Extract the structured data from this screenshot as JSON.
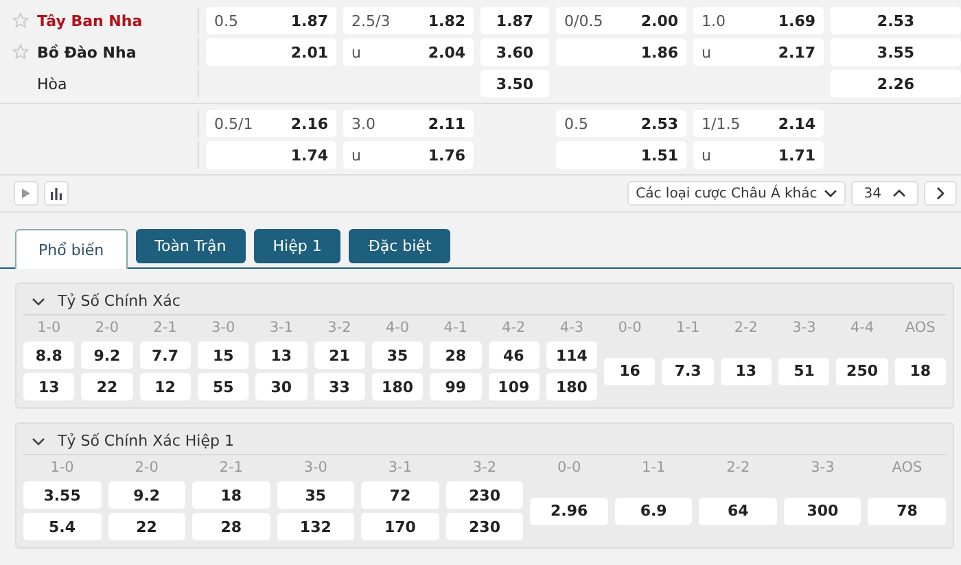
{
  "odds_blocks": [
    {
      "rows": [
        {
          "team": {
            "name": "Tây Ban Nha",
            "kind": "team",
            "highlighted": true
          },
          "cells": [
            {
              "kind": "pair",
              "label": "0.5",
              "odd": "1.87"
            },
            {
              "kind": "pair",
              "label": "2.5/3",
              "odd": "1.82"
            },
            {
              "kind": "single",
              "odd": "1.87"
            },
            {
              "kind": "pair",
              "label": "0/0.5",
              "odd": "2.00"
            },
            {
              "kind": "pair",
              "label": "1.0",
              "odd": "1.69"
            },
            {
              "kind": "single",
              "odd": "2.53"
            }
          ]
        },
        {
          "team": {
            "name": "Bồ Đào Nha",
            "kind": "team",
            "highlighted": false
          },
          "cells": [
            {
              "kind": "pair",
              "odd": "2.01"
            },
            {
              "kind": "pair",
              "label": "u",
              "odd": "2.04"
            },
            {
              "kind": "single",
              "odd": "3.60"
            },
            {
              "kind": "pair",
              "odd": "1.86"
            },
            {
              "kind": "pair",
              "label": "u",
              "odd": "2.17"
            },
            {
              "kind": "single",
              "odd": "3.55"
            }
          ]
        },
        {
          "team": {
            "name": "Hòa",
            "kind": "draw",
            "highlighted": false
          },
          "cells": [
            {
              "kind": "blank"
            },
            {
              "kind": "blank"
            },
            {
              "kind": "single",
              "odd": "3.50"
            },
            {
              "kind": "blank"
            },
            {
              "kind": "blank"
            },
            {
              "kind": "single",
              "odd": "2.26"
            }
          ]
        }
      ]
    },
    {
      "rows": [
        {
          "cells": [
            {
              "kind": "pair",
              "label": "0.5/1",
              "odd": "2.16"
            },
            {
              "kind": "pair",
              "label": "3.0",
              "odd": "2.11"
            },
            {
              "kind": "blank"
            },
            {
              "kind": "pair",
              "label": "0.5",
              "odd": "2.53"
            },
            {
              "kind": "pair",
              "label": "1/1.5",
              "odd": "2.14"
            },
            {
              "kind": "blank"
            }
          ]
        },
        {
          "cells": [
            {
              "kind": "pair",
              "odd": "1.74"
            },
            {
              "kind": "pair",
              "label": "u",
              "odd": "1.76"
            },
            {
              "kind": "blank"
            },
            {
              "kind": "pair",
              "odd": "1.51"
            },
            {
              "kind": "pair",
              "label": "u",
              "odd": "1.71"
            },
            {
              "kind": "blank"
            }
          ]
        }
      ]
    }
  ],
  "toolbar": {
    "market_select": "Các loại cược Châu Á khác",
    "count": "34"
  },
  "tabs": [
    {
      "label": "Phổ biến",
      "selected": true
    },
    {
      "label": "Toàn Trận",
      "selected": false
    },
    {
      "label": "Hiệp 1",
      "selected": false
    },
    {
      "label": "Đặc biệt",
      "selected": false
    }
  ],
  "sections": [
    {
      "title": "Tỷ Số Chính Xác",
      "expanded": true,
      "win_scores": [
        {
          "label": "1-0",
          "home": "8.8",
          "away": "13"
        },
        {
          "label": "2-0",
          "home": "9.2",
          "away": "22"
        },
        {
          "label": "2-1",
          "home": "7.7",
          "away": "12"
        },
        {
          "label": "3-0",
          "home": "15",
          "away": "55"
        },
        {
          "label": "3-1",
          "home": "13",
          "away": "30"
        },
        {
          "label": "3-2",
          "home": "21",
          "away": "33"
        },
        {
          "label": "4-0",
          "home": "35",
          "away": "180"
        },
        {
          "label": "4-1",
          "home": "28",
          "away": "99"
        },
        {
          "label": "4-2",
          "home": "46",
          "away": "109"
        },
        {
          "label": "4-3",
          "home": "114",
          "away": "180"
        }
      ],
      "draw_scores": [
        {
          "label": "0-0",
          "odd": "16"
        },
        {
          "label": "1-1",
          "odd": "7.3"
        },
        {
          "label": "2-2",
          "odd": "13"
        },
        {
          "label": "3-3",
          "odd": "51"
        },
        {
          "label": "4-4",
          "odd": "250"
        },
        {
          "label": "AOS",
          "odd": "18"
        }
      ]
    },
    {
      "title": "Tỷ Số Chính Xác Hiệp 1",
      "expanded": true,
      "win_scores": [
        {
          "label": "1-0",
          "home": "3.55",
          "away": "5.4"
        },
        {
          "label": "2-0",
          "home": "9.2",
          "away": "22"
        },
        {
          "label": "2-1",
          "home": "18",
          "away": "28"
        },
        {
          "label": "3-0",
          "home": "35",
          "away": "132"
        },
        {
          "label": "3-1",
          "home": "72",
          "away": "170"
        },
        {
          "label": "3-2",
          "home": "230",
          "away": "230"
        }
      ],
      "draw_scores": [
        {
          "label": "0-0",
          "odd": "2.96"
        },
        {
          "label": "1-1",
          "odd": "6.9"
        },
        {
          "label": "2-2",
          "odd": "64"
        },
        {
          "label": "3-3",
          "odd": "300"
        },
        {
          "label": "AOS",
          "odd": "78"
        }
      ]
    }
  ]
}
